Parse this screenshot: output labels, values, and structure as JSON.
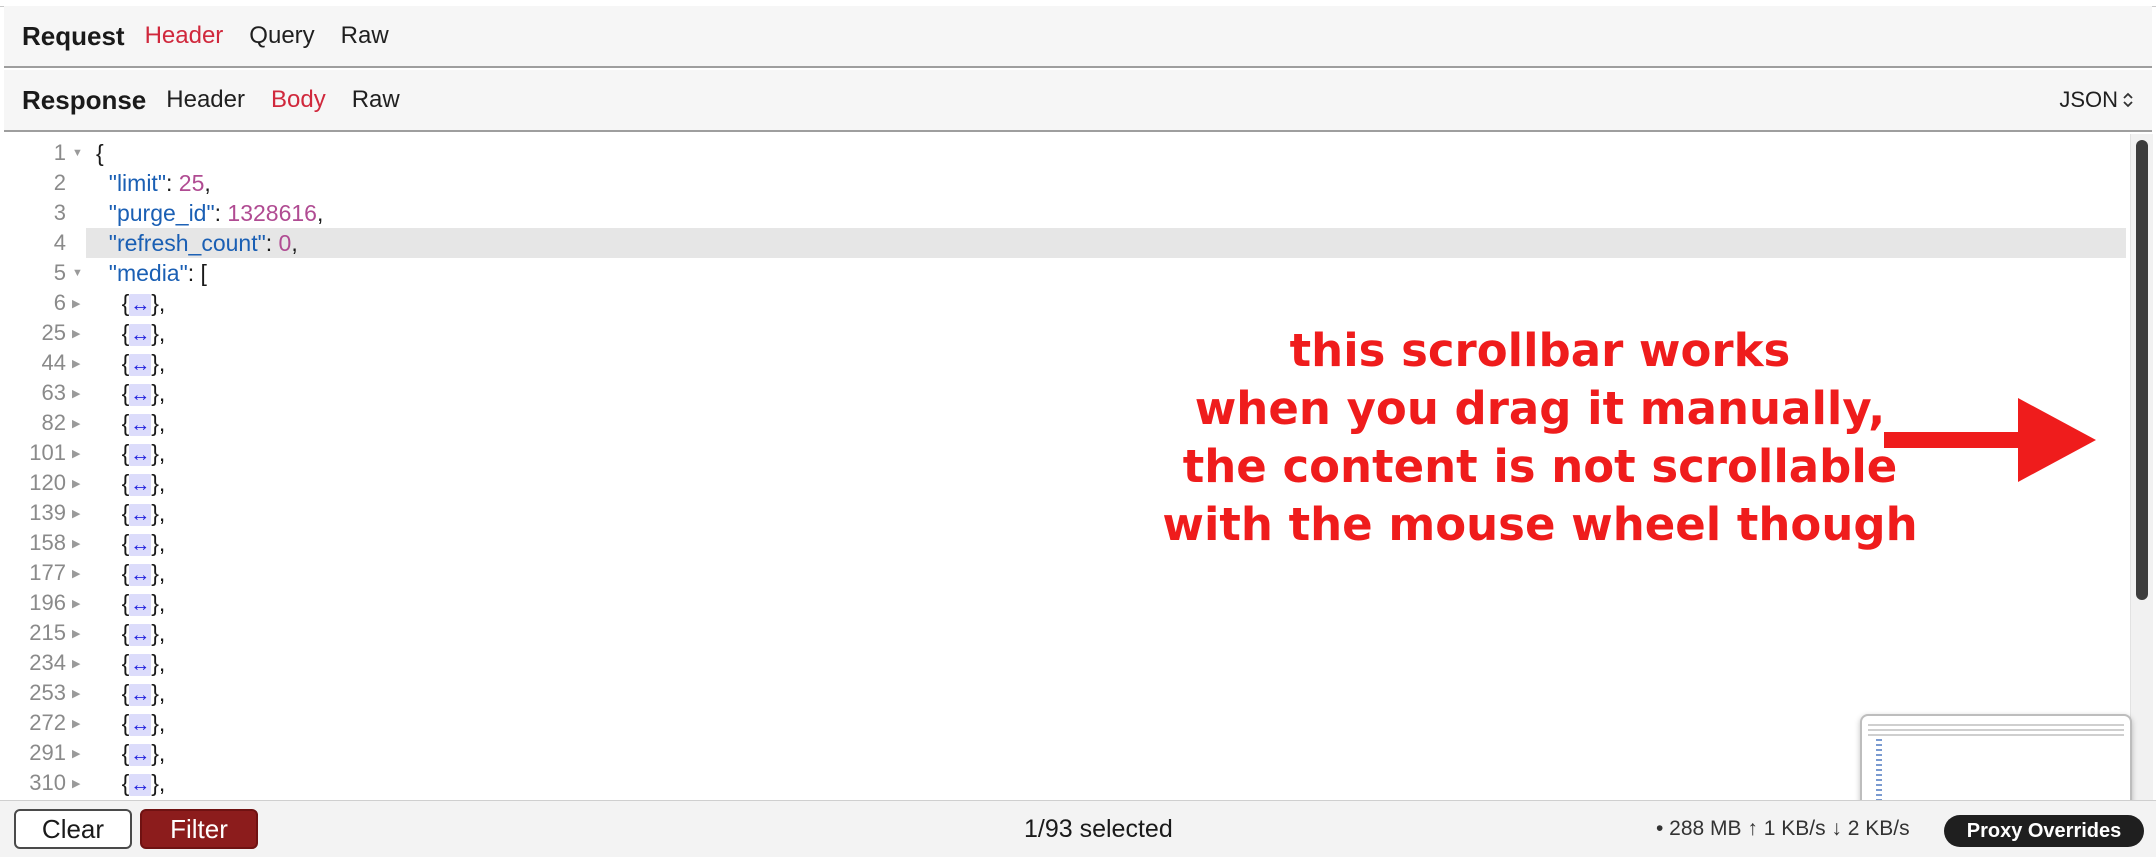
{
  "request": {
    "title": "Request",
    "tabs": [
      {
        "label": "Header",
        "active": true
      },
      {
        "label": "Query",
        "active": false
      },
      {
        "label": "Raw",
        "active": false
      }
    ]
  },
  "response": {
    "title": "Response",
    "tabs": [
      {
        "label": "Header",
        "active": false
      },
      {
        "label": "Body",
        "active": true
      },
      {
        "label": "Raw",
        "active": false
      }
    ],
    "format": "JSON"
  },
  "editor": {
    "highlighted_line": 4,
    "lines": [
      {
        "num": "1",
        "fold": "open",
        "text": "{"
      },
      {
        "num": "2",
        "key": "\"limit\"",
        "value": "25",
        "suffix": ","
      },
      {
        "num": "3",
        "key": "\"purge_id\"",
        "value": "1328616",
        "suffix": ","
      },
      {
        "num": "4",
        "key": "\"refresh_count\"",
        "value": "0",
        "suffix": ","
      },
      {
        "num": "5",
        "fold": "open",
        "key": "\"media\"",
        "suffix": ": ["
      },
      {
        "num": "6",
        "fold": "closed",
        "collapsed": true
      },
      {
        "num": "25",
        "fold": "closed",
        "collapsed": true
      },
      {
        "num": "44",
        "fold": "closed",
        "collapsed": true
      },
      {
        "num": "63",
        "fold": "closed",
        "collapsed": true
      },
      {
        "num": "82",
        "fold": "closed",
        "collapsed": true
      },
      {
        "num": "101",
        "fold": "closed",
        "collapsed": true
      },
      {
        "num": "120",
        "fold": "closed",
        "collapsed": true
      },
      {
        "num": "139",
        "fold": "closed",
        "collapsed": true
      },
      {
        "num": "158",
        "fold": "closed",
        "collapsed": true
      },
      {
        "num": "177",
        "fold": "closed",
        "collapsed": true
      },
      {
        "num": "196",
        "fold": "closed",
        "collapsed": true
      },
      {
        "num": "215",
        "fold": "closed",
        "collapsed": true
      },
      {
        "num": "234",
        "fold": "closed",
        "collapsed": true
      },
      {
        "num": "253",
        "fold": "closed",
        "collapsed": true
      },
      {
        "num": "272",
        "fold": "closed",
        "collapsed": true
      },
      {
        "num": "291",
        "fold": "closed",
        "collapsed": true
      },
      {
        "num": "310",
        "fold": "closed",
        "collapsed": true
      }
    ],
    "collapsed_symbol": "↔",
    "collapsed_open": "{",
    "collapsed_close": "},"
  },
  "annotation": {
    "lines": [
      "this scrollbar works",
      "when you drag it manually,",
      "the content is not scrollable",
      "with the mouse wheel though"
    ],
    "color": "#ef1c1c"
  },
  "footer": {
    "clear_label": "Clear",
    "filter_label": "Filter",
    "selected_text": "1/93 selected",
    "stats_text": "• 288 MB ↑ 1 KB/s ↓ 2 KB/s",
    "proxy_label": "Proxy Overrides"
  },
  "colors": {
    "active_tab": "#d0283c",
    "json_key": "#1a5fb4",
    "json_number": "#b04b92",
    "filter_button": "#8c1c1c"
  }
}
